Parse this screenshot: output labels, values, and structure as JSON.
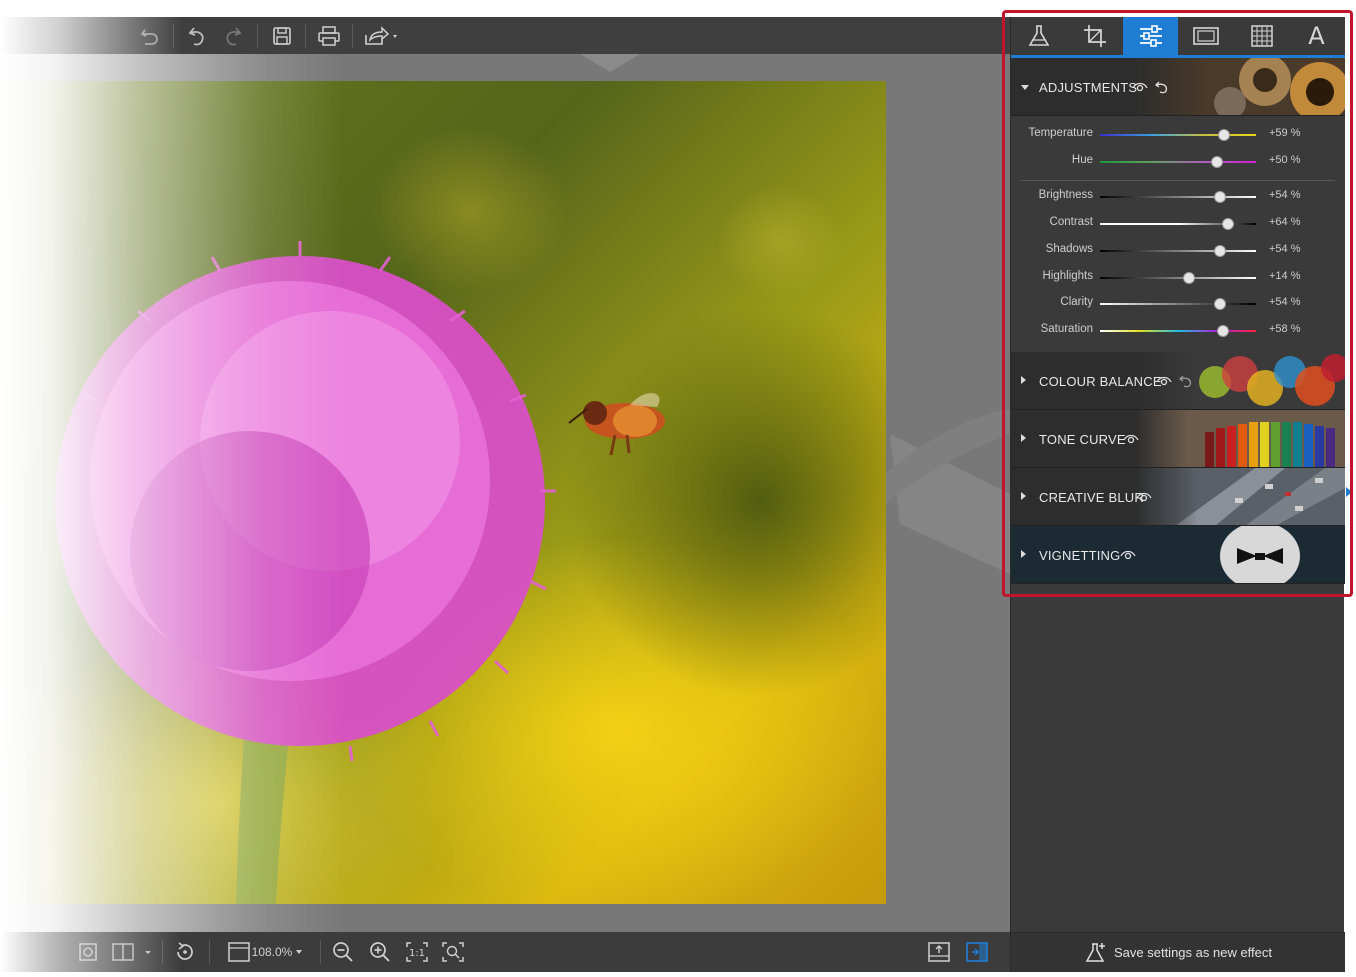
{
  "toolbar": {
    "icons": [
      "undo-all-icon",
      "undo-icon",
      "redo-icon",
      "save-icon",
      "print-icon",
      "share-icon"
    ]
  },
  "bottom_bar": {
    "zoom": "108.0%"
  },
  "panel": {
    "tabs": [
      {
        "icon": "flask-icon",
        "active": false
      },
      {
        "icon": "crop-icon",
        "active": false
      },
      {
        "icon": "adjust-sliders-icon",
        "active": true
      },
      {
        "icon": "frame-icon",
        "active": false
      },
      {
        "icon": "texture-icon",
        "active": false
      },
      {
        "icon": "text-icon",
        "glyph": "A",
        "active": false
      }
    ],
    "sections": [
      {
        "title": "ADJUSTMENTS",
        "expanded": true
      },
      {
        "title": "COLOUR BALANCE",
        "expanded": false
      },
      {
        "title": "TONE CURVE",
        "expanded": false
      },
      {
        "title": "CREATIVE BLUR",
        "expanded": false
      },
      {
        "title": "VIGNETTING",
        "expanded": false
      }
    ],
    "adjustments": [
      {
        "label": "Temperature",
        "value": "+59 %",
        "level": 59,
        "colors": [
          "#3b2fd1",
          "#3aa0e0",
          "#c8c040",
          "#e6d51a"
        ]
      },
      {
        "label": "Hue",
        "value": "+50 %",
        "level": 50,
        "colors": [
          "#1b9a3a",
          "#60a060",
          "#b060c0",
          "#d020d0"
        ]
      },
      {
        "label": "Brightness",
        "value": "+54 %",
        "level": 54,
        "colors": [
          "#000000",
          "#ffffff"
        ]
      },
      {
        "label": "Contrast",
        "value": "+64 %",
        "level": 64,
        "colors": [
          "#ffffff",
          "#ffffff",
          "#000000"
        ]
      },
      {
        "label": "Shadows",
        "value": "+54 %",
        "level": 54,
        "colors": [
          "#000000",
          "#ffffff"
        ]
      },
      {
        "label": "Highlights",
        "value": "+14 %",
        "level": 14,
        "colors": [
          "#000000",
          "#ffffff"
        ]
      },
      {
        "label": "Clarity",
        "value": "+54 %",
        "level": 54,
        "colors": [
          "#ffffff",
          "#000000"
        ]
      },
      {
        "label": "Saturation",
        "value": "+58 %",
        "level": 58,
        "colors": [
          "#ffffff",
          "#e0e020",
          "#20c0e0",
          "#b020e0",
          "#ff2040"
        ]
      }
    ],
    "save_effect_label": "Save settings as new effect"
  },
  "colors": {
    "accent": "#1f7ed4",
    "highlight_border": "#c0152d",
    "panel_bg": "#3a3a3a"
  }
}
